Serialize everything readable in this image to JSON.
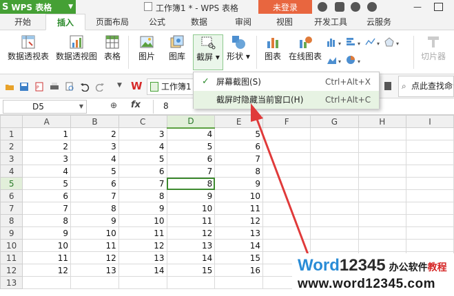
{
  "titlebar": {
    "app_button": "WPS 表格",
    "doc_title": "工作簿1 * - WPS 表格",
    "login": "未登录"
  },
  "tabs": [
    "开始",
    "插入",
    "页面布局",
    "公式",
    "数据",
    "审阅",
    "视图",
    "开发工具",
    "云服务"
  ],
  "active_tab": "插入",
  "ribbon": {
    "pivot_table": "数据透视表",
    "pivot_chart": "数据透视图",
    "table": "表格",
    "picture": "图片",
    "gallery": "图库",
    "screenshot": "截屏",
    "shapes": "形状",
    "chart": "图表",
    "online_chart": "在线图表",
    "slicer": "切片器"
  },
  "quickaccess": {
    "workbook_tab": "工作簿1",
    "search": "点此查找命令"
  },
  "formula_bar": {
    "cell_ref": "D5",
    "fx": "fx",
    "content": "8"
  },
  "grid": {
    "columns": [
      "A",
      "B",
      "C",
      "D",
      "E",
      "F",
      "G",
      "H",
      "I"
    ],
    "rows": [
      [
        "1",
        "2",
        "3",
        "4",
        "5"
      ],
      [
        "2",
        "3",
        "4",
        "5",
        "6"
      ],
      [
        "3",
        "4",
        "5",
        "6",
        "7"
      ],
      [
        "4",
        "5",
        "6",
        "7",
        "8"
      ],
      [
        "5",
        "6",
        "7",
        "8",
        "9"
      ],
      [
        "6",
        "7",
        "8",
        "9",
        "10"
      ],
      [
        "7",
        "8",
        "9",
        "10",
        "11"
      ],
      [
        "8",
        "9",
        "10",
        "11",
        "12"
      ],
      [
        "9",
        "10",
        "11",
        "12",
        "13"
      ],
      [
        "10",
        "11",
        "12",
        "13",
        "14"
      ],
      [
        "11",
        "12",
        "13",
        "14",
        "15"
      ],
      [
        "12",
        "13",
        "14",
        "15",
        "16"
      ]
    ],
    "row_numbers": [
      "1",
      "2",
      "3",
      "4",
      "5",
      "6",
      "7",
      "8",
      "9",
      "10",
      "11",
      "12",
      "13"
    ],
    "selected": {
      "row": 5,
      "col": "D"
    }
  },
  "menu": {
    "items": [
      {
        "label": "屏幕截图(S)",
        "shortcut": "Ctrl+Alt+X",
        "checked": "✓"
      },
      {
        "label": "截屏时隐藏当前窗口(H)",
        "shortcut": "Ctrl+Alt+C"
      }
    ]
  },
  "watermark": {
    "brand_a": "Word",
    "brand_b": "12345",
    "tag_a": "办公软件",
    "tag_b": "教程",
    "url": "www.word12345.com"
  },
  "colors": {
    "accent_green": "#45a035",
    "login_orange": "#e8663f",
    "arrow_red": "#e03a3a"
  }
}
